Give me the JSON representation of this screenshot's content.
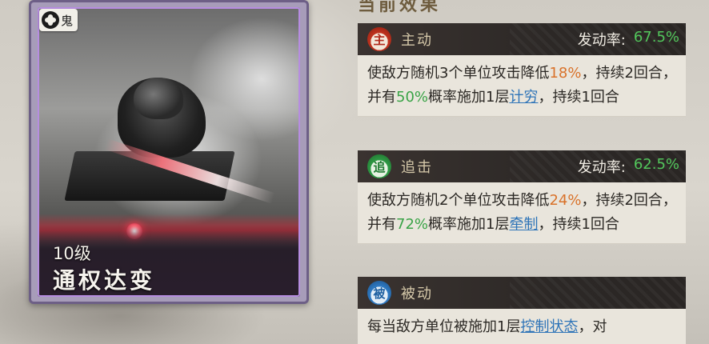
{
  "card": {
    "badge": "鬼",
    "level": "10级",
    "title": "通权达变"
  },
  "section": {
    "title": "当前效果"
  },
  "effects": [
    {
      "icon_char": "主",
      "icon_color": "#c1341f",
      "type": "主动",
      "rate_label": "发动率:",
      "rate_value": "67.5%",
      "desc": [
        {
          "t": "使敌方随机3个单位攻击降低",
          "c": ""
        },
        {
          "t": "18%",
          "c": "hl-orange"
        },
        {
          "t": "，持续2回合，并有",
          "c": ""
        },
        {
          "t": "50%",
          "c": "hl-green"
        },
        {
          "t": "概率施加1层",
          "c": ""
        },
        {
          "t": "计穷",
          "c": "hl-link"
        },
        {
          "t": "，持续1回合",
          "c": ""
        }
      ]
    },
    {
      "icon_char": "追",
      "icon_color": "#2f9b45",
      "type": "追击",
      "rate_label": "发动率:",
      "rate_value": "62.5%",
      "desc": [
        {
          "t": "使敌方随机2个单位攻击降低",
          "c": ""
        },
        {
          "t": "24%",
          "c": "hl-orange"
        },
        {
          "t": "，持续2回合，并有",
          "c": ""
        },
        {
          "t": "72%",
          "c": "hl-green"
        },
        {
          "t": "概率施加1层",
          "c": ""
        },
        {
          "t": "牵制",
          "c": "hl-link"
        },
        {
          "t": "，持续1回合",
          "c": ""
        }
      ]
    },
    {
      "icon_char": "被",
      "icon_color": "#2f7bc4",
      "type": "被动",
      "rate_label": "",
      "rate_value": "",
      "desc": [
        {
          "t": "每当敌方单位被施加1层",
          "c": ""
        },
        {
          "t": "控制状态",
          "c": "hl-link"
        },
        {
          "t": "，对",
          "c": ""
        }
      ]
    }
  ],
  "colors": {
    "rate_green": "#52c65b",
    "highlight_orange": "#d9722a",
    "link_blue": "#2e74b8",
    "card_border": "#b68de0"
  }
}
